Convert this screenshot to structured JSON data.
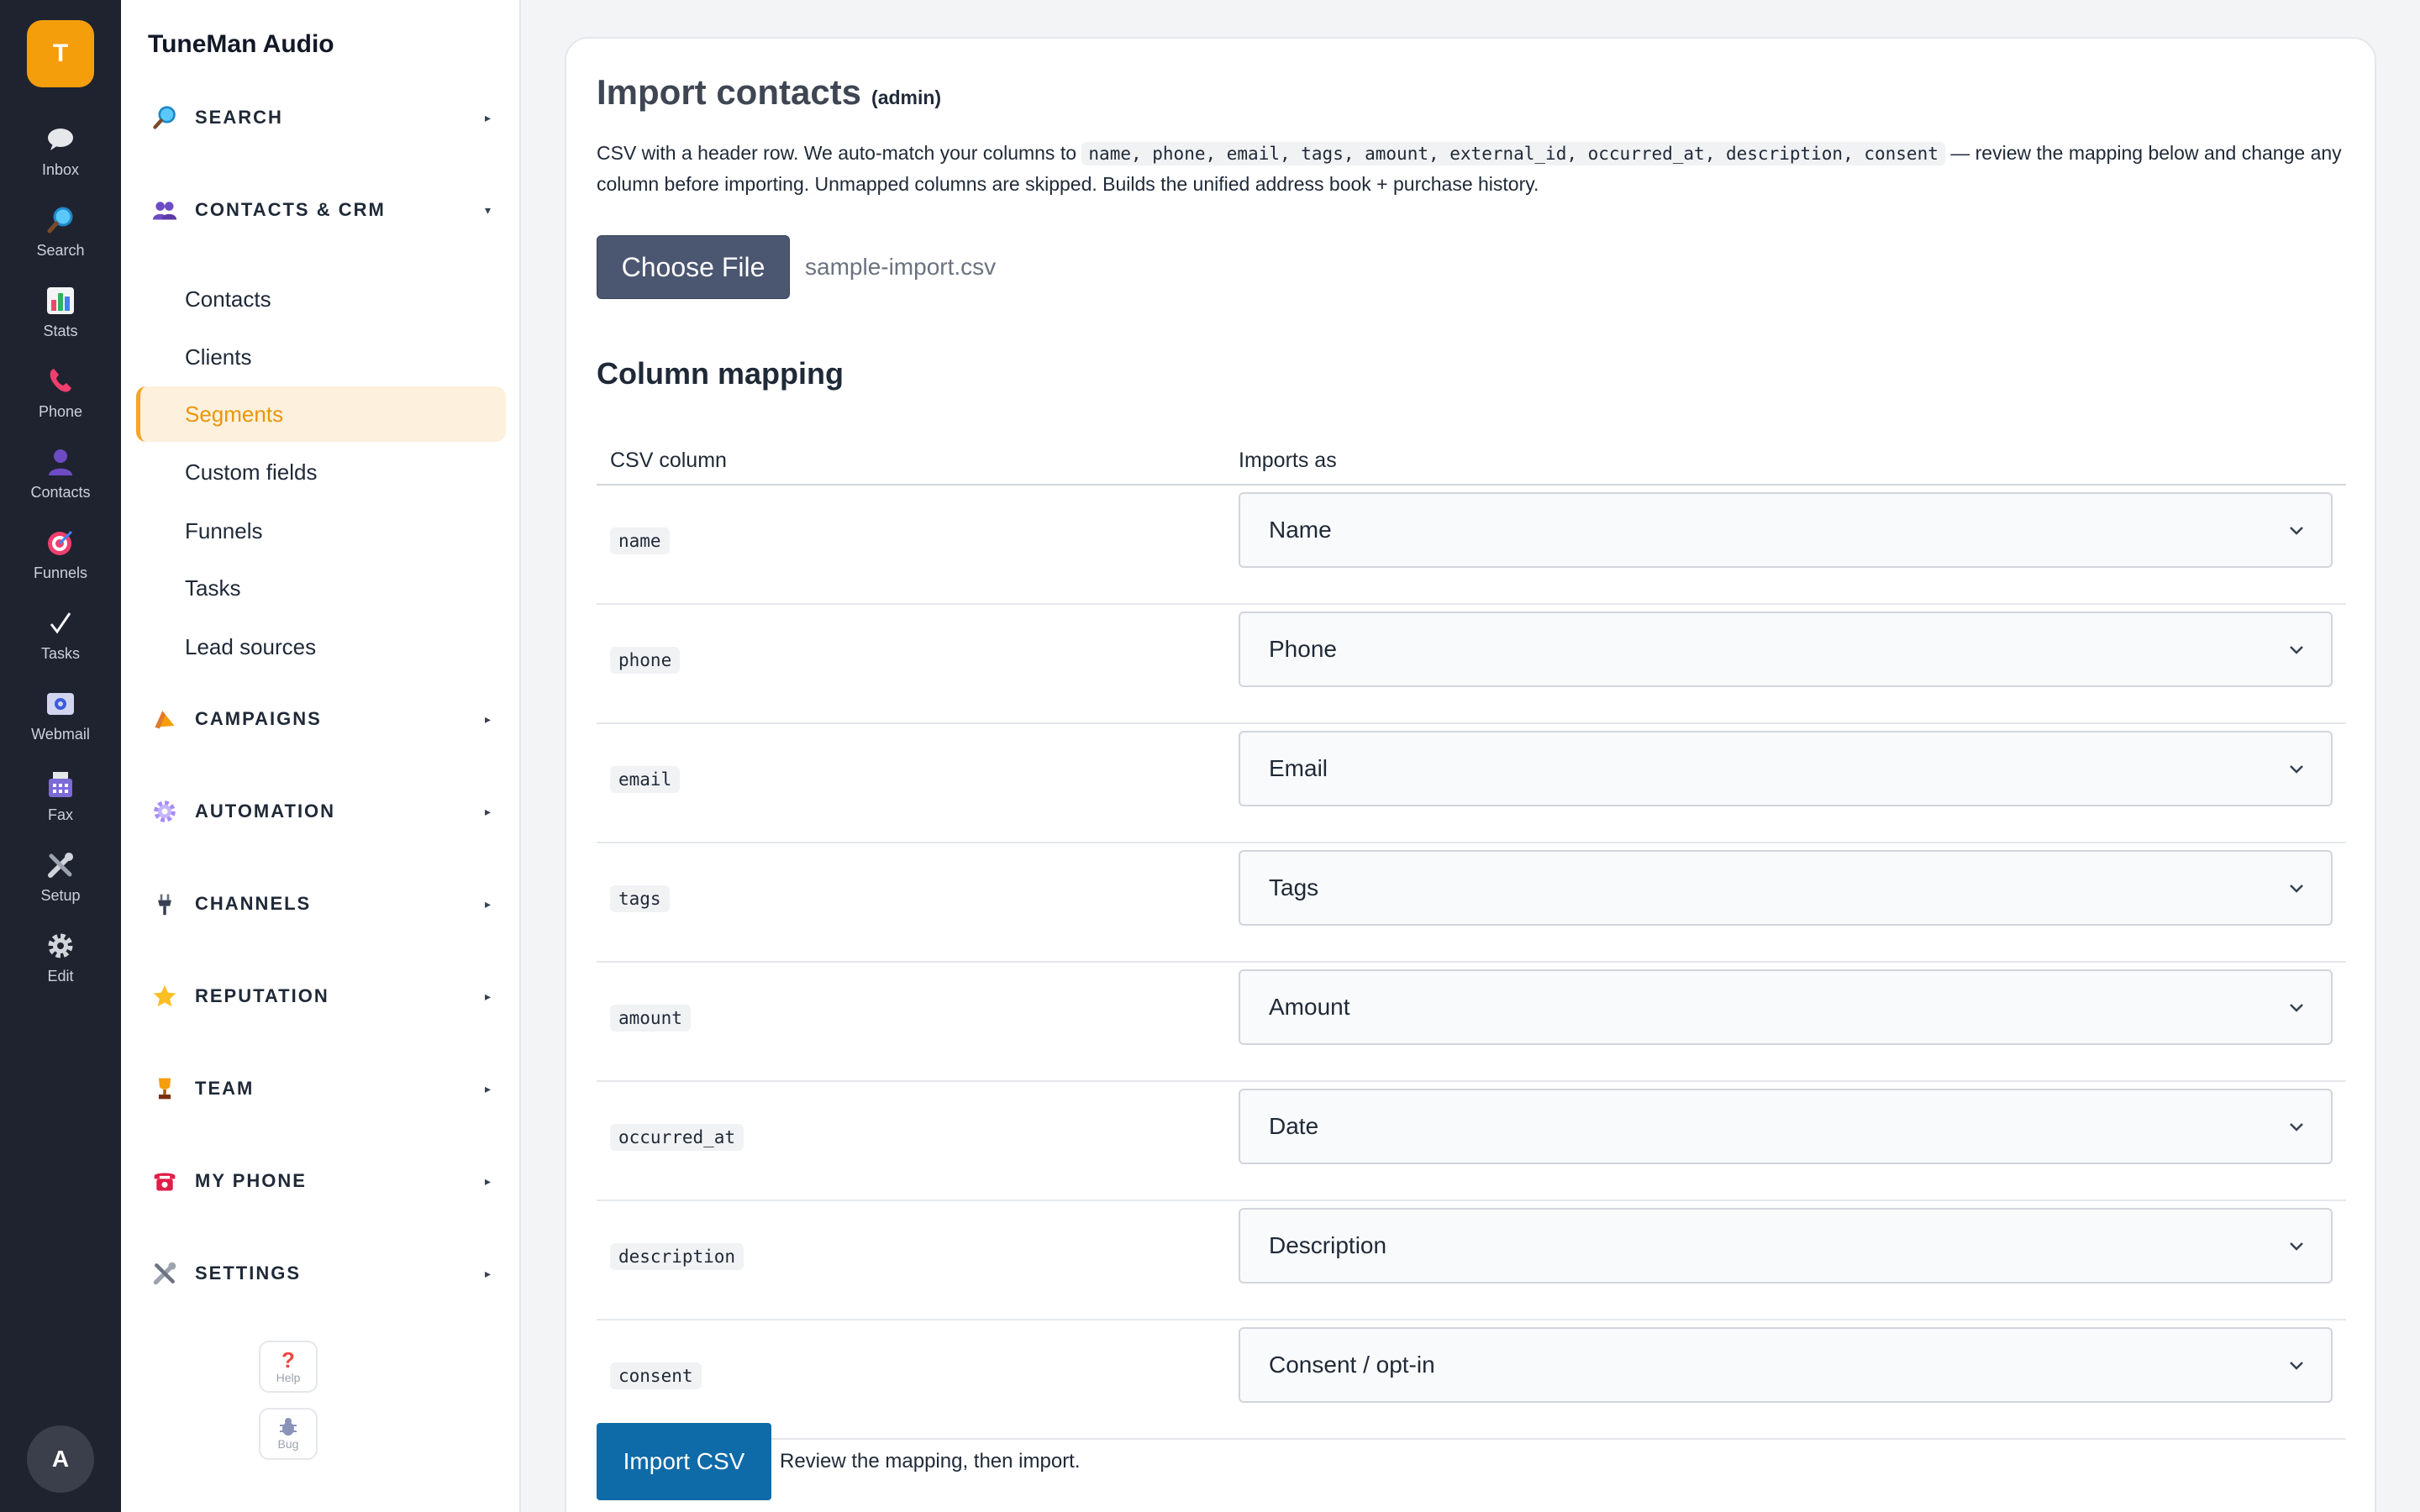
{
  "app": {
    "logo_letter": "T",
    "avatar_letter": "A",
    "brand_name": "TuneMan Audio"
  },
  "rail": {
    "items": [
      {
        "label": "Inbox",
        "icon": "speech-bubble-icon"
      },
      {
        "label": "Search",
        "icon": "magnifier-icon"
      },
      {
        "label": "Stats",
        "icon": "bar-chart-icon"
      },
      {
        "label": "Phone",
        "icon": "phone-icon"
      },
      {
        "label": "Contacts",
        "icon": "person-icon"
      },
      {
        "label": "Funnels",
        "icon": "target-icon"
      },
      {
        "label": "Tasks",
        "icon": "checkmark-icon"
      },
      {
        "label": "Webmail",
        "icon": "at-sign-icon"
      },
      {
        "label": "Fax",
        "icon": "fax-icon"
      },
      {
        "label": "Setup",
        "icon": "tools-icon"
      },
      {
        "label": "Edit",
        "icon": "gear-icon"
      }
    ]
  },
  "sidebar": {
    "sections": [
      {
        "label": "SEARCH",
        "icon": "magnifier-icon",
        "caret": "▸"
      },
      {
        "label": "CONTACTS & CRM",
        "icon": "people-icon",
        "caret": "▾"
      },
      {
        "label": "CAMPAIGNS",
        "icon": "megaphone-icon",
        "caret": "▸"
      },
      {
        "label": "AUTOMATION",
        "icon": "gear-icon",
        "caret": "▸"
      },
      {
        "label": "CHANNELS",
        "icon": "plug-icon",
        "caret": "▸"
      },
      {
        "label": "REPUTATION",
        "icon": "star-icon",
        "caret": "▸"
      },
      {
        "label": "TEAM",
        "icon": "trophy-icon",
        "caret": "▸"
      },
      {
        "label": "MY PHONE",
        "icon": "telephone-icon",
        "caret": "▸"
      },
      {
        "label": "SETTINGS",
        "icon": "tools-icon",
        "caret": "▸"
      }
    ],
    "crm_items": [
      {
        "label": "Contacts",
        "active": false
      },
      {
        "label": "Clients",
        "active": false
      },
      {
        "label": "Segments",
        "active": true
      },
      {
        "label": "Custom fields",
        "active": false
      },
      {
        "label": "Funnels",
        "active": false
      },
      {
        "label": "Tasks",
        "active": false
      },
      {
        "label": "Lead sources",
        "active": false
      }
    ],
    "help_label": "Help",
    "bug_label": "Bug"
  },
  "main": {
    "title": "Import contacts",
    "title_tag": "(admin)",
    "desc_before": "CSV with a header row. We auto-match your columns to",
    "desc_code": "name, phone, email, tags, amount, external_id, occurred_at, description, consent",
    "desc_after": "— review the mapping below and change any column before importing. Unmapped columns are skipped. Builds the unified address book + purchase history.",
    "choose_file_label": "Choose File",
    "file_name": "sample-import.csv",
    "mapping_heading": "Column mapping",
    "col_header_csv": "CSV column",
    "col_header_imports": "Imports as",
    "rows": [
      {
        "column": "name",
        "imports_as": "Name"
      },
      {
        "column": "phone",
        "imports_as": "Phone"
      },
      {
        "column": "email",
        "imports_as": "Email"
      },
      {
        "column": "tags",
        "imports_as": "Tags"
      },
      {
        "column": "amount",
        "imports_as": "Amount"
      },
      {
        "column": "occurred_at",
        "imports_as": "Date"
      },
      {
        "column": "description",
        "imports_as": "Description"
      },
      {
        "column": "consent",
        "imports_as": "Consent / opt-in"
      }
    ],
    "import_button_label": "Import CSV",
    "import_hint": "Review the mapping, then import."
  },
  "colors": {
    "rail_bg": "#1f2330",
    "accent": "#f5a623",
    "primary_button": "#0f6aa8",
    "choose_button": "#4b5670"
  }
}
